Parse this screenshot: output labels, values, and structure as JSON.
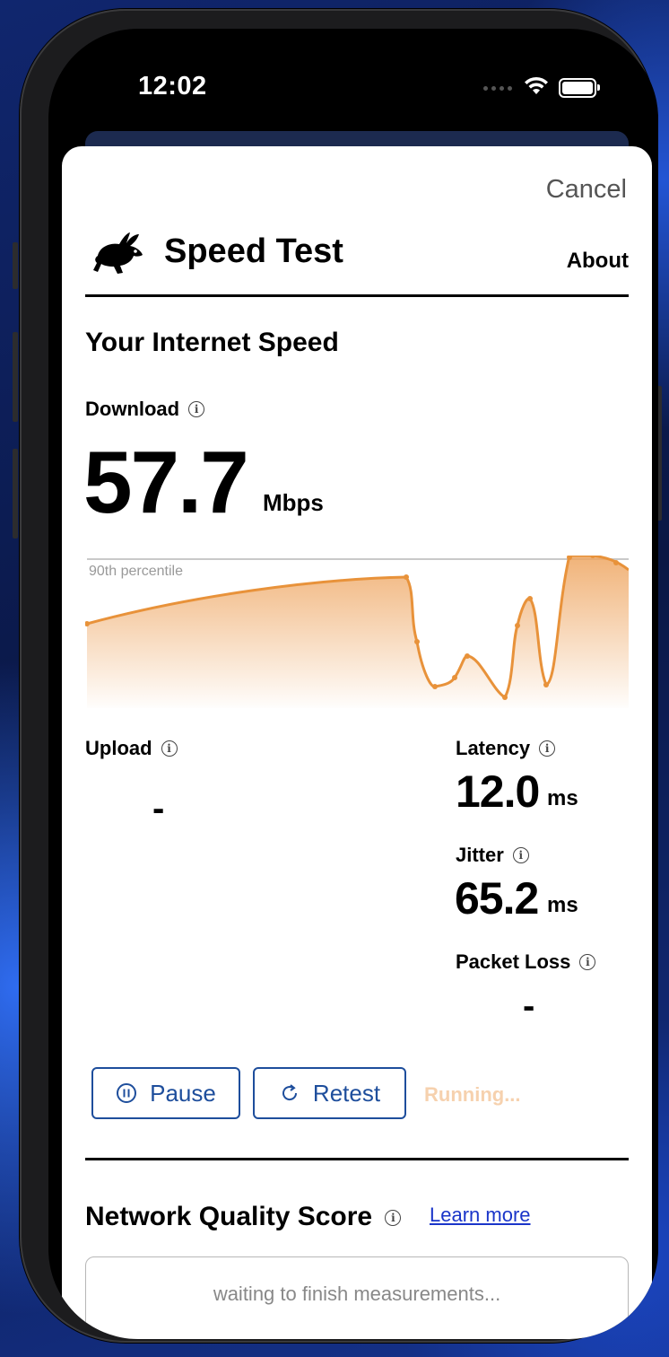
{
  "status_bar": {
    "time": "12:02"
  },
  "sheet": {
    "cancel_label": "Cancel",
    "app_title": "Speed Test",
    "about_label": "About",
    "section_title": "Your Internet Speed",
    "download": {
      "label": "Download",
      "value": "57.7",
      "unit": "Mbps"
    },
    "chart_reference_label": "90th percentile",
    "upload": {
      "label": "Upload",
      "value": "-"
    },
    "latency": {
      "label": "Latency",
      "value": "12.0",
      "unit": "ms"
    },
    "jitter": {
      "label": "Jitter",
      "value": "65.2",
      "unit": "ms"
    },
    "packet_loss": {
      "label": "Packet Loss",
      "value": "-"
    },
    "buttons": {
      "pause_label": "Pause",
      "retest_label": "Retest"
    },
    "status_text": "Running...",
    "network_quality": {
      "title": "Network Quality Score",
      "learn_more": "Learn more",
      "waiting_text": "waiting to finish measurements..."
    }
  },
  "colors": {
    "accent_blue": "#1e4e9c",
    "chart_line": "#e8923a",
    "link": "#1a35c9",
    "running_text": "#f6d1ae"
  },
  "icons": [
    "rabbit-logo",
    "info-icon",
    "pause-icon",
    "retest-icon",
    "wifi-icon",
    "battery-icon"
  ]
}
